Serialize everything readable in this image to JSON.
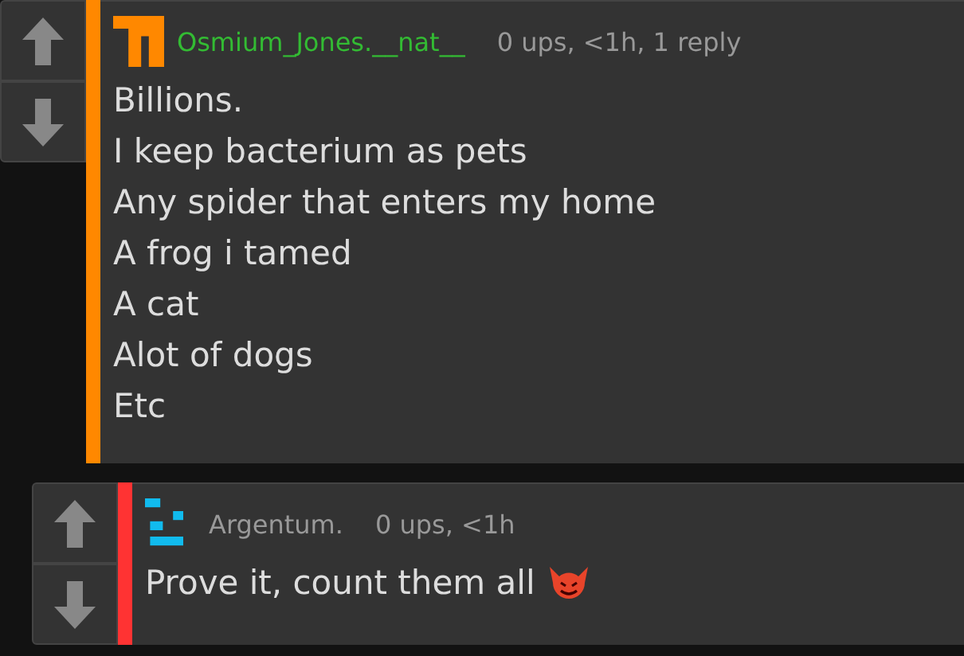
{
  "comments": [
    {
      "color": "#ff8800",
      "avatar": {
        "kind": "block",
        "color": "#ff8800"
      },
      "username": "Osmium_Jones.__nat__",
      "highlighted": true,
      "meta": "0 ups, <1h, 1 reply",
      "lines": [
        "Billions.",
        "I keep bacterium as pets",
        "Any spider that enters my home",
        "A frog i tamed",
        "A cat",
        "Alot of dogs",
        "Etc"
      ],
      "devil_icon": false
    },
    {
      "color": "#ff3333",
      "avatar": {
        "kind": "bars",
        "color": "#11bbee"
      },
      "username": "Argentum.",
      "highlighted": false,
      "meta": "0 ups, <1h",
      "lines": [
        "Prove it, count them all"
      ],
      "devil_icon": true
    }
  ]
}
